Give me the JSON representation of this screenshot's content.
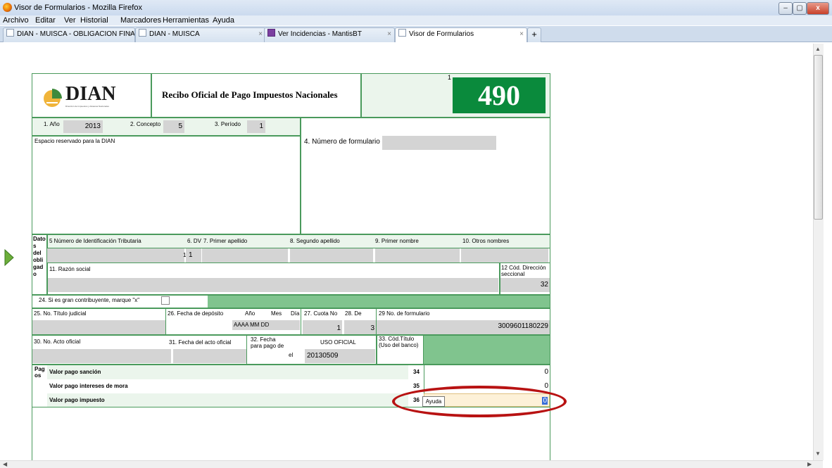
{
  "window": {
    "title": "Visor de Formularios - Mozilla Firefox",
    "min": "–",
    "max": "▢",
    "close": "x"
  },
  "menu": [
    "Archivo",
    "Editar",
    "Ver",
    "Historial",
    "Marcadores",
    "Herramientas",
    "Ayuda"
  ],
  "tabs": [
    {
      "label": "DIAN - MUISCA - OBLIGACION FINA...",
      "close": "×"
    },
    {
      "label": "DIAN - MUISCA",
      "close": "×"
    },
    {
      "label": "Ver Incidencias - MantisBT",
      "close": "×"
    },
    {
      "label": "Visor de Formularios",
      "close": "×"
    }
  ],
  "new_tab": "+",
  "form": {
    "logo": "DIAN",
    "logo_sub": "Dirección de Impuestos y Aduanas Nacionales",
    "title": "Recibo Oficial de Pago Impuestos Nacionales",
    "corner_num": "1",
    "form_number": "490",
    "anio_label": "1. Año",
    "anio_value": "2013",
    "concepto_label": "2. Concepto",
    "concepto_value": "5",
    "periodo_label": "3. Período",
    "periodo_value": "1",
    "num_form_label": "4. Número de formulario",
    "reserved_label": "Espacio reservado para la DIAN",
    "datos_label": "Dato s del obli gad o",
    "nit_label": "5 Número de Identificación Tributaria",
    "dv_label": "6. DV",
    "dv_value": "1",
    "dv_side": "1",
    "ap1_label": "7. Primer apellido",
    "ap2_label": "8. Segundo apellido",
    "nom1_label": "9. Primer nombre",
    "nom2_label": "10. Otros nombres",
    "razon_label": "11. Razón social",
    "seccional_label": "12 Cód. Dirección seccional",
    "seccional_value": "32",
    "gran_label": "24. Si es gran contribuyente, marque \"x\"",
    "titulo_label": "25. No. Título judicial",
    "fecha_dep_label": "26. Fecha de depósito",
    "anio_h": "Año",
    "mes_h": "Mes",
    "dia_h": "Día",
    "fecha_fmt": "AAAA  MM  DD",
    "cuota_label": "27. Cuota No",
    "cuota_value": "1",
    "de_label": "28. De",
    "de_value": "3",
    "no_form_label": "29 No. de formulario",
    "no_form_value": "3009601180229",
    "acto_label": "30. No. Acto oficial",
    "fecha_acto_label": "31. Fecha del acto oficial",
    "fecha_pago_label": "32. Fecha para pago de",
    "el_label": "el",
    "uso_label": "USO OFICIAL",
    "fecha_pago_value": "20130509",
    "cod_titulo_label": "33. Cód.Título (Uso del banco)",
    "pagos_label": "Pag os",
    "sancion_label": "Valor pago sanción",
    "sancion_num": "34",
    "sancion_value": "0",
    "mora_label": "Valor pago intereses de mora",
    "mora_num": "35",
    "mora_value": "0",
    "impuesto_label": "Valor pago impuesto",
    "impuesto_num": "36",
    "impuesto_value": "0",
    "ayuda_label": "Ayuda"
  }
}
